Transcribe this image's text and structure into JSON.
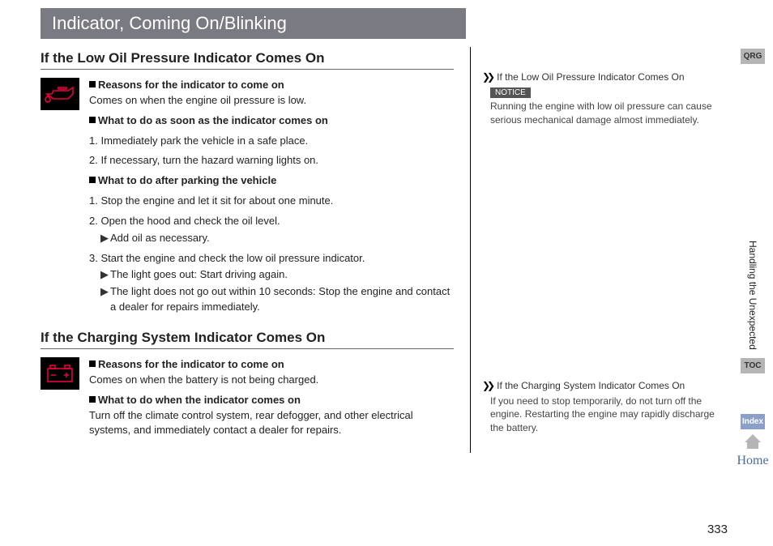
{
  "banner": "Indicator, Coming On/Blinking",
  "oil": {
    "title": "If the Low Oil Pressure Indicator Comes On",
    "h1": "Reasons for the indicator to come on",
    "p1": "Comes on when the engine oil pressure is low.",
    "h2": "What to do as soon as the indicator comes on",
    "s1": "1. Immediately park the vehicle in a safe place.",
    "s2": "2. If necessary, turn the hazard warning lights on.",
    "h3": "What to do after parking the vehicle",
    "s3": "1. Stop the engine and let it sit for about one minute.",
    "s4": "2. Open the hood and check the oil level.",
    "s4a": "Add oil as necessary.",
    "s5": "3. Start the engine and check the low oil pressure indicator.",
    "s5a": "The light goes out: Start driving again.",
    "s5b": "The light does not go out within 10 seconds: Stop the engine and contact a dealer for repairs immediately.",
    "side_title": "If the Low Oil Pressure Indicator Comes On",
    "notice": "NOTICE",
    "side_body": "Running the engine with low oil pressure can cause serious mechanical damage almost immediately."
  },
  "charge": {
    "title": "If the Charging System Indicator Comes On",
    "h1": "Reasons for the indicator to come on",
    "p1": "Comes on when the battery is not being charged.",
    "h2": "What to do when the indicator comes on",
    "p2": "Turn off the climate control system, rear defogger, and other electrical systems, and immediately contact a dealer for repairs.",
    "side_title": "If the Charging System Indicator Comes On",
    "side_body": "If you need to stop temporarily, do not turn off the engine. Restarting the engine may rapidly discharge the battery."
  },
  "rail": {
    "qrg": "QRG",
    "section": "Handling the Unexpected",
    "toc": "TOC",
    "index": "Index",
    "home": "Home"
  },
  "page_number": "333"
}
